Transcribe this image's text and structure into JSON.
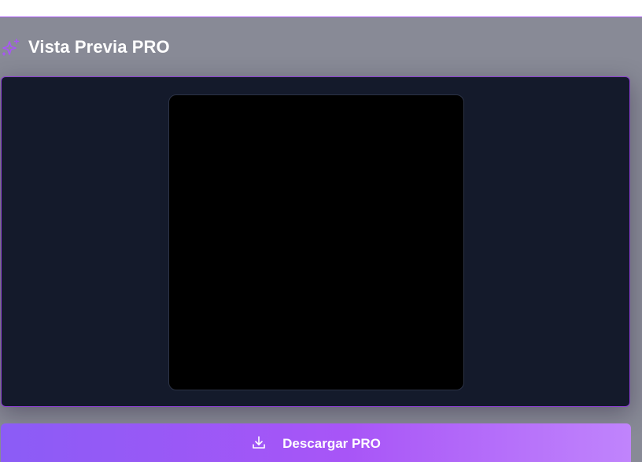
{
  "header": {
    "title": "Vista Previa PRO",
    "icon": "sparkle-icon"
  },
  "preview": {
    "background": "#141a2b",
    "border_color": "#8b3fd0",
    "canvas_color": "#000000"
  },
  "actions": {
    "download_label": "Descargar PRO",
    "download_icon": "download-icon"
  },
  "colors": {
    "accent": "#a855f7",
    "button_gradient_start": "#8b5cf6",
    "button_gradient_end": "#c084fc"
  }
}
